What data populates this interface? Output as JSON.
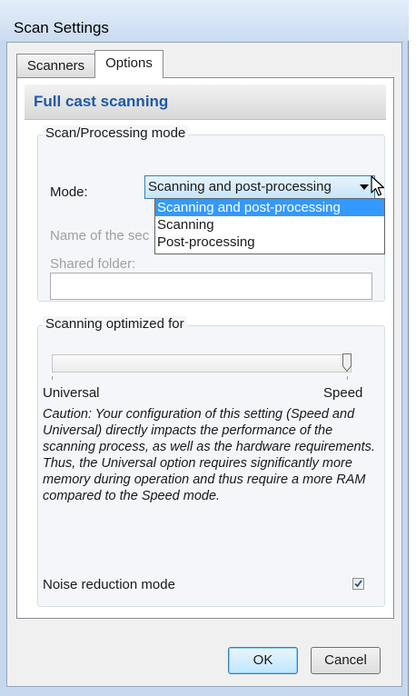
{
  "window": {
    "title": "Scan Settings"
  },
  "tabs": [
    {
      "label": "Scanners",
      "active": false
    },
    {
      "label": "Options",
      "active": true
    }
  ],
  "header": {
    "title": "Full cast scanning"
  },
  "scan_processing": {
    "group_label": "Scan/Processing mode",
    "mode_label": "Mode:",
    "mode_value": "Scanning and post-processing",
    "mode_options": [
      "Scanning and post-processing",
      "Scanning",
      "Post-processing"
    ],
    "name_label": "Name of the sec",
    "shared_folder_label": "Shared folder:",
    "shared_folder_value": ""
  },
  "optimization": {
    "group_label": "Scanning optimized for",
    "slider_min_label": "Universal",
    "slider_max_label": "Speed",
    "slider_position": 1.0,
    "caution": "Caution: Your configuration of this setting (Speed and Universal) directly impacts the performance of the scanning process, as well as the hardware requirements. Thus, the Universal option requires significantly more memory during operation and thus require a more RAM compared to the Speed mode.",
    "noise_reduction_label": "Noise reduction mode",
    "noise_reduction_checked": true
  },
  "buttons": {
    "ok": "OK",
    "cancel": "Cancel"
  },
  "colors": {
    "header_text": "#1c5aa6",
    "selection": "#3399ff",
    "window_frame": "#c5d8ee"
  }
}
